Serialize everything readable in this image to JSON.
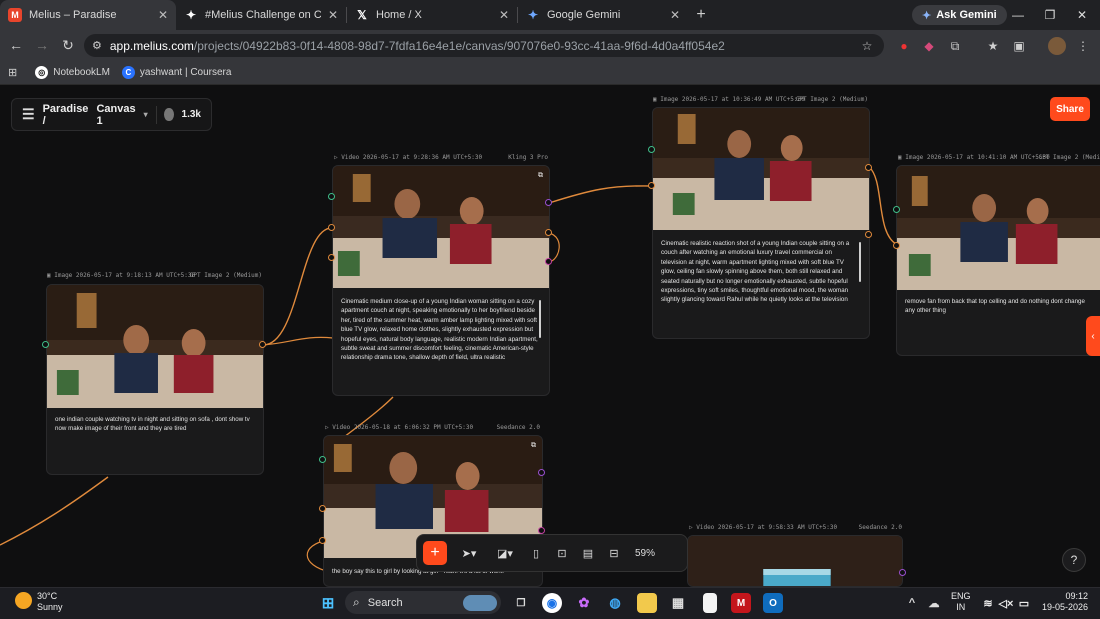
{
  "browser": {
    "tabs": [
      {
        "title": "Melius – Paradise",
        "favicon": "melius-icon",
        "active": true
      },
      {
        "title": "#Melius Challenge on Contra",
        "favicon": "contra-icon",
        "active": false
      },
      {
        "title": "Home / X",
        "favicon": "x-icon",
        "active": false
      },
      {
        "title": "Google Gemini",
        "favicon": "gemini-icon",
        "active": false
      }
    ],
    "ask_gemini": "Ask Gemini",
    "url_host": "app.melius.com",
    "url_path": "/projects/04922b83-0f14-4808-98d7-7fdfa16e4e1e/canvas/907076e0-93cc-41aa-9f6d-4d0a4ff054e2",
    "bookmarks": [
      {
        "label": "NotebookLM",
        "icon": "notebooklm-icon"
      },
      {
        "label": "yashwant | Coursera",
        "icon": "coursera-icon"
      }
    ]
  },
  "canvas": {
    "project": {
      "name": "Paradise /",
      "canvas": "Canvas 1",
      "credits": "1.3k"
    },
    "share_label": "Share",
    "zoom": "59%",
    "nodes": [
      {
        "id": "n1",
        "type": "Image",
        "header": "Image 2026-05-17 at 9:18:13 AM UTC+5:30",
        "model": "GPT Image 2 (Medium)",
        "prompt": "one indian couple watching tv in night  and sitting on sofa , dont show tv now make image of their front and they are tired"
      },
      {
        "id": "n2",
        "type": "Video",
        "header": "Video 2026-05-17 at 9:28:36 AM UTC+5:30",
        "model": "Kling 3 Pro",
        "prompt": "Cinematic medium close-up of a young Indian woman sitting on a cozy apartment couch at night, speaking emotionally to her boyfriend beside her, tired of the summer heat, warm amber lamp lighting mixed with soft blue TV glow, relaxed home clothes, slightly exhausted expression but hopeful eyes, natural body language, realistic modern Indian apartment, subtle sweat and summer discomfort feeling, cinematic American-style relationship drama tone, shallow depth of field, ultra realistic"
      },
      {
        "id": "n3",
        "type": "Image",
        "header": "Image 2026-05-17 at 10:36:49 AM UTC+5:30",
        "model": "GPT Image 2 (Medium)",
        "prompt": "Cinematic realistic reaction shot of a young Indian couple sitting on a couch after watching an emotional luxury travel commercial on television at night, warm apartment lighting mixed with soft blue TV glow, ceiling fan slowly spinning above them, both still relaxed and seated naturally but no longer emotionally exhausted, subtle hopeful expressions, tiny soft smiles, thoughtful emotional mood, the woman slightly glancing toward Rahul while he quietly looks at the television"
      },
      {
        "id": "n4",
        "type": "Image",
        "header": "Image 2026-05-17 at 10:41:10 AM UTC+5:30",
        "model": "GPT Image 2 (Medi",
        "prompt": "remove  fan from back that top celling and do nothing dont change any other thing"
      },
      {
        "id": "n5",
        "type": "Video",
        "header": "Video 2026-05-18 at 6:06:32 PM UTC+5:30",
        "model": "Seedance 2.0",
        "prompt": "the boy say this to girl by looking at girl  \"Yeah. It's a lot of work.\""
      },
      {
        "id": "n6",
        "type": "Video",
        "header": "Video 2026-05-17 at 9:58:33 AM UTC+5:30",
        "model": "Seedance 2.0",
        "prompt": ""
      }
    ]
  },
  "taskbar": {
    "weather_temp": "30°C",
    "weather_desc": "Sunny",
    "search_label": "Search",
    "lang_1": "ENG",
    "lang_2": "IN",
    "time": "09:12",
    "date": "19-05-2026"
  },
  "colors": {
    "accent": "#ff4a1c",
    "port_green": "#3fbf8a",
    "port_orange": "#e08a3c",
    "port_purple": "#9a4fd0"
  }
}
